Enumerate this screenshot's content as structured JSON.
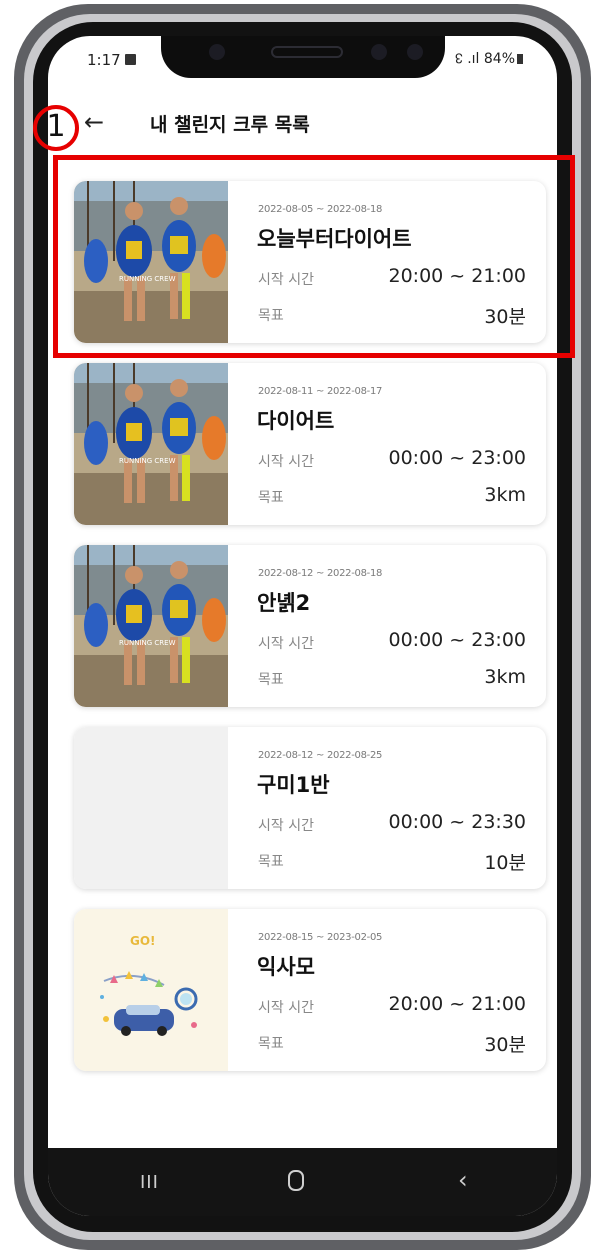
{
  "status_bar": {
    "time": "1:17",
    "right_text": "↋ .ıl 84%"
  },
  "header": {
    "back_icon": "←",
    "title": "내 챌린지 크루 목록"
  },
  "labels": {
    "start_time": "시작 시간",
    "goal": "목표"
  },
  "cards": [
    {
      "date_range": "2022-08-05 ~ 2022-08-18",
      "name": "오늘부터다이어트",
      "start_time": "20:00 ~ 21:00",
      "goal": "30분",
      "thumbnail": "runners"
    },
    {
      "date_range": "2022-08-11 ~ 2022-08-17",
      "name": "다이어트",
      "start_time": "00:00 ~ 23:00",
      "goal": "3km",
      "thumbnail": "runners"
    },
    {
      "date_range": "2022-08-12 ~ 2022-08-18",
      "name": "안녥2",
      "start_time": "00:00 ~ 23:00",
      "goal": "3km",
      "thumbnail": "runners"
    },
    {
      "date_range": "2022-08-12 ~ 2022-08-25",
      "name": "구미1반",
      "start_time": "00:00 ~ 23:30",
      "goal": "10분",
      "thumbnail": "blank"
    },
    {
      "date_range": "2022-08-15 ~ 2023-02-05",
      "name": "익사모",
      "start_time": "20:00 ~ 21:00",
      "goal": "30분",
      "thumbnail": "go"
    }
  ],
  "go_illustration_text": "GO!",
  "runners_banner_text": "RUNNING CREW",
  "nav": {
    "recent_icon": "III",
    "back_icon": "‹"
  },
  "annotation": {
    "number": "1"
  },
  "colors": {
    "annotation": "#e60000",
    "nav_bar": "#141414"
  }
}
